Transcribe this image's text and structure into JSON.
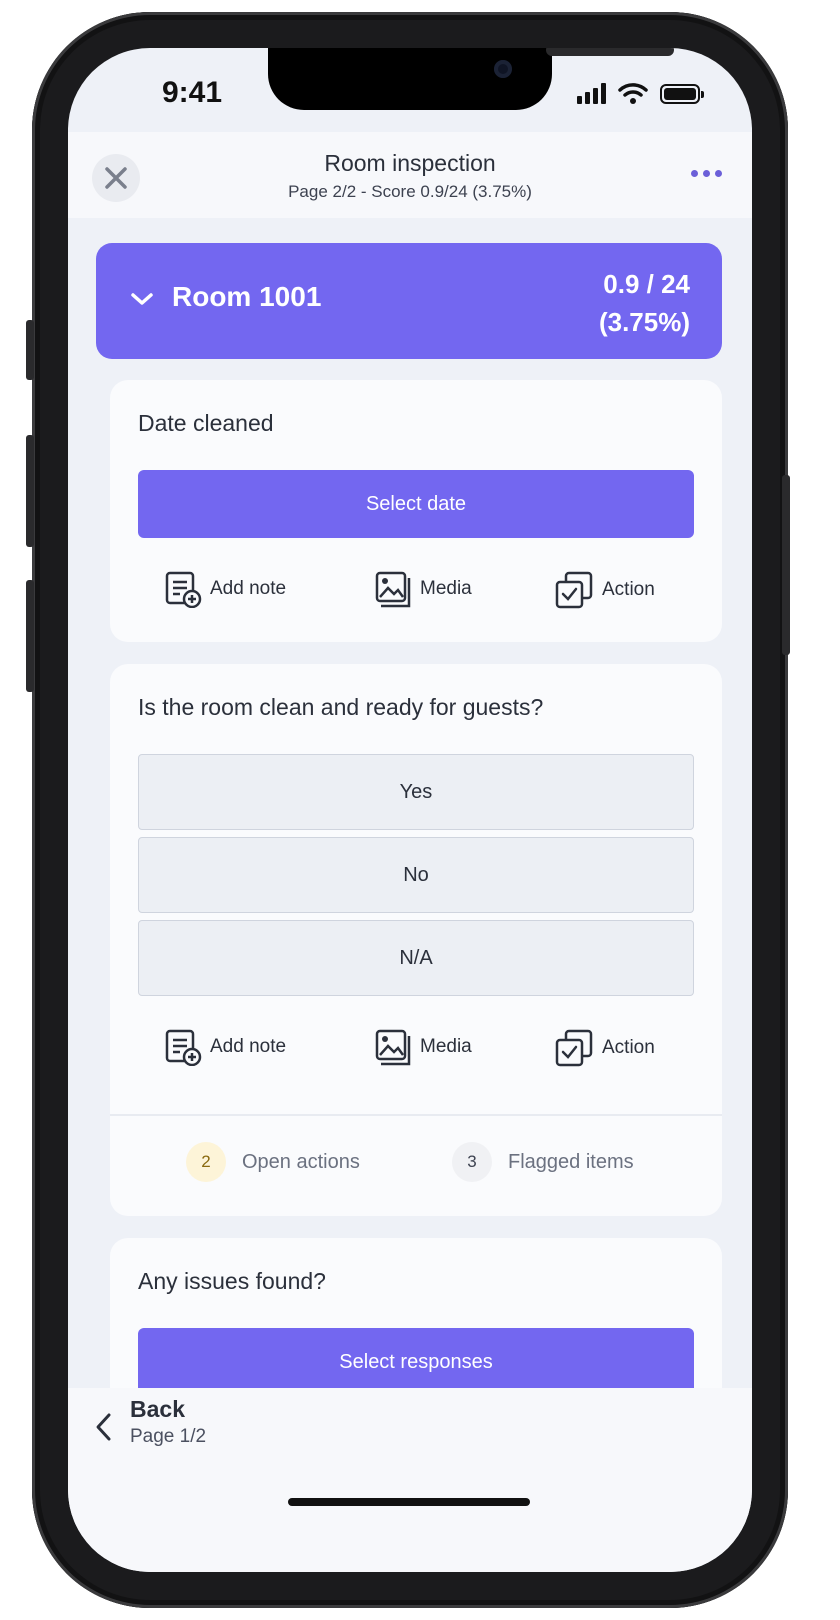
{
  "status_bar": {
    "time": "9:41"
  },
  "header": {
    "title": "Room inspection",
    "subtitle": "Page 2/2 - Score 0.9/24 (3.75%)"
  },
  "section": {
    "name": "Room 1001",
    "score_line1": "0.9 / 24",
    "score_line2": "(3.75%)"
  },
  "questions": [
    {
      "label": "Date cleaned",
      "button": "Select date"
    },
    {
      "label": "Is the room clean and ready for guests?",
      "options": [
        "Yes",
        "No",
        "N/A"
      ]
    },
    {
      "label": "Any issues found?",
      "button": "Select responses"
    }
  ],
  "tools": {
    "add_note": "Add note",
    "media": "Media",
    "action": "Action"
  },
  "summary": {
    "open_actions_count": "2",
    "open_actions_label": "Open actions",
    "flagged_count": "3",
    "flagged_label": "Flagged items"
  },
  "footer": {
    "back_label": "Back",
    "back_page": "Page 1/2"
  },
  "colors": {
    "accent": "#7367f0",
    "background": "#eef1f7",
    "card": "#fafbfd"
  }
}
